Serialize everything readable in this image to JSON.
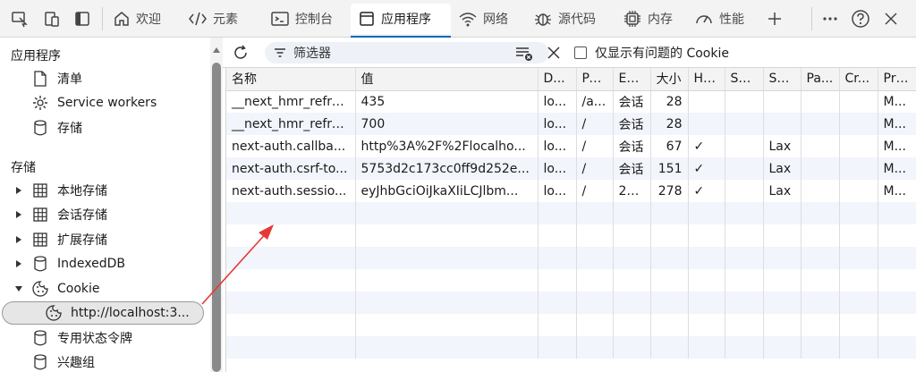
{
  "toolbar": {
    "tabs": [
      {
        "label": "欢迎",
        "icon": "home-icon"
      },
      {
        "label": "元素",
        "icon": "code-icon"
      },
      {
        "label": "控制台",
        "icon": "console-icon"
      },
      {
        "label": "应用程序",
        "icon": "application-icon",
        "active": true
      },
      {
        "label": "网络",
        "icon": "wifi-icon"
      },
      {
        "label": "源代码",
        "icon": "bug-icon"
      },
      {
        "label": "内存",
        "icon": "chip-icon"
      },
      {
        "label": "性能",
        "icon": "gauge-icon"
      }
    ],
    "accent": "#0067c0"
  },
  "sidebar": {
    "app_heading": "应用程序",
    "app_items": [
      {
        "label": "清单",
        "icon": "file-icon"
      },
      {
        "label": "Service workers",
        "icon": "gear-icon"
      },
      {
        "label": "存储",
        "icon": "database-icon"
      }
    ],
    "storage_heading": "存储",
    "storage_items": [
      {
        "label": "本地存储",
        "icon": "grid-icon",
        "expanded": false
      },
      {
        "label": "会话存储",
        "icon": "grid-icon",
        "expanded": false
      },
      {
        "label": "扩展存储",
        "icon": "grid-icon",
        "expanded": false
      },
      {
        "label": "IndexedDB",
        "icon": "database-icon",
        "expanded": false
      },
      {
        "label": "Cookie",
        "icon": "cookie-icon",
        "expanded": true
      }
    ],
    "cookie_origin": "http://localhost:3...",
    "more_items": [
      {
        "label": "专用状态令牌",
        "icon": "database-icon"
      },
      {
        "label": "兴趣组",
        "icon": "database-icon"
      }
    ]
  },
  "filterbar": {
    "filter_placeholder": "筛选器",
    "only_issues_label": "仅显示有问题的 Cookie"
  },
  "cookie_table": {
    "headers": [
      "名称",
      "值",
      "D...",
      "Pa...",
      "Ex...",
      "大小",
      "Ht...",
      "Se...",
      "Sa...",
      "Pa...",
      "Cr...",
      "Pri..."
    ],
    "rows": [
      [
        "__next_hmr_refre...",
        "435",
        "lo...",
        "/a...",
        "会话",
        "28",
        "",
        "",
        "",
        "",
        "",
        "M..."
      ],
      [
        "__next_hmr_refre...",
        "700",
        "lo...",
        "/",
        "会话",
        "28",
        "",
        "",
        "",
        "",
        "",
        "M..."
      ],
      [
        "next-auth.callba...",
        "http%3A%2F%2Flocalho...",
        "lo...",
        "/",
        "会话",
        "67",
        "✓",
        "",
        "Lax",
        "",
        "",
        "M..."
      ],
      [
        "next-auth.csrf-to...",
        "5753d2c173cc0ff9d252e...",
        "lo...",
        "/",
        "会话",
        "151",
        "✓",
        "",
        "Lax",
        "",
        "",
        "M..."
      ],
      [
        "next-auth.sessio...",
        "eyJhbGciOiJkaXIiLCJlbm...",
        "lo...",
        "/",
        "20...",
        "278",
        "✓",
        "",
        "Lax",
        "",
        "",
        "M..."
      ]
    ]
  }
}
